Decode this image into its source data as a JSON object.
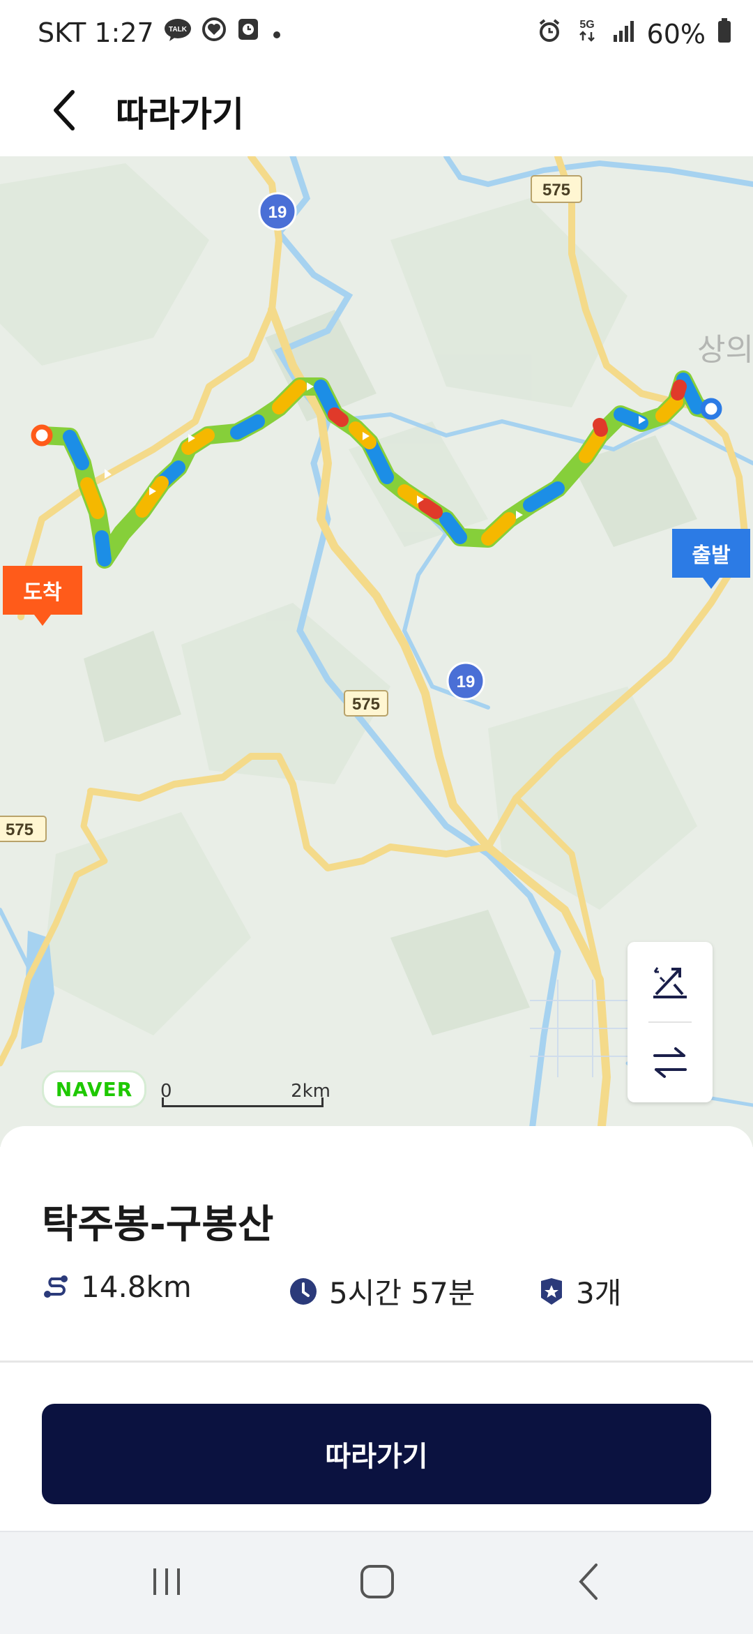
{
  "status_bar": {
    "carrier_time": "SKT 1:27",
    "icons_left": [
      "talk-icon",
      "heart-icon",
      "clock-app-icon",
      "dot-icon"
    ],
    "talk_badge": "TALK",
    "network": "5G",
    "battery": "60%",
    "icons_right": [
      "alarm-icon",
      "5g-icon",
      "signal-icon",
      "battery-icon"
    ]
  },
  "header": {
    "title": "따라가기",
    "back_icon": "chevron-left-icon"
  },
  "map": {
    "markers": {
      "end_label": "도착",
      "start_label": "출발"
    },
    "road_labels": {
      "route_575_top": "575",
      "route_19_top": "19",
      "route_19_mid": "19",
      "route_575_mid": "575",
      "route_575_left": "575"
    },
    "place_label": "상의",
    "provider": "NAVER",
    "scale": {
      "min": "0",
      "max": "2km"
    },
    "controls": [
      "elevation-toggle-icon",
      "reverse-route-icon"
    ],
    "colors": {
      "route_green": "#86cf3a",
      "route_yellow": "#f5b800",
      "route_blue": "#1c8ee6",
      "route_red": "#e03a2a",
      "road": "#fbe6a8",
      "water": "#a6d2f0"
    }
  },
  "course": {
    "title": "탁주봉-구봉산",
    "distance": "14.8km",
    "duration": "5시간 57분",
    "checkpoints": "3개",
    "icons": [
      "route-distance-icon",
      "clock-icon",
      "badge-star-icon"
    ]
  },
  "cta": {
    "label": "따라가기"
  },
  "nav": {
    "icons": [
      "recent-apps-icon",
      "home-icon",
      "back-icon"
    ]
  },
  "accent": "#0b1240"
}
